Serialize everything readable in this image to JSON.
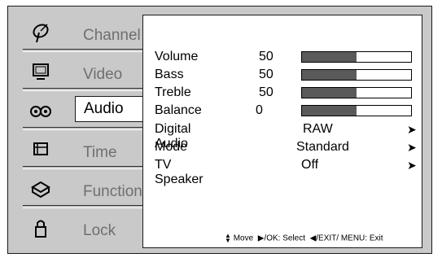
{
  "sidebar": {
    "items": [
      {
        "label": "Channel",
        "icon": "satellite-dish-icon"
      },
      {
        "label": "Video",
        "icon": "monitor-icon"
      },
      {
        "label": "Audio",
        "icon": "audio-icon",
        "selected": true
      },
      {
        "label": "Time",
        "icon": "time-icon"
      },
      {
        "label": "Function",
        "icon": "function-icon"
      },
      {
        "label": "Lock",
        "icon": "padlock-icon"
      }
    ]
  },
  "audio": {
    "volume": {
      "label": "Volume",
      "value": "50",
      "level": 0.5
    },
    "bass": {
      "label": "Bass",
      "value": "50",
      "level": 0.5
    },
    "treble": {
      "label": "Treble",
      "value": "50",
      "level": 0.5
    },
    "balance": {
      "label": "Balance",
      "value": "0",
      "level": 0.5
    },
    "digital_audio": {
      "label": "Digital Audio",
      "value": "RAW"
    },
    "mode": {
      "label": "Mode",
      "value": "Standard"
    },
    "tv_speaker": {
      "label": "TV Speaker",
      "value": "Off"
    }
  },
  "footer": {
    "move": "Move",
    "select": "▶/OK: Select",
    "exit": "◀/EXIT/ MENU: Exit"
  },
  "colors": {
    "panel_bg": "#c9c9c9",
    "slider_fill": "#5a5a5a"
  }
}
